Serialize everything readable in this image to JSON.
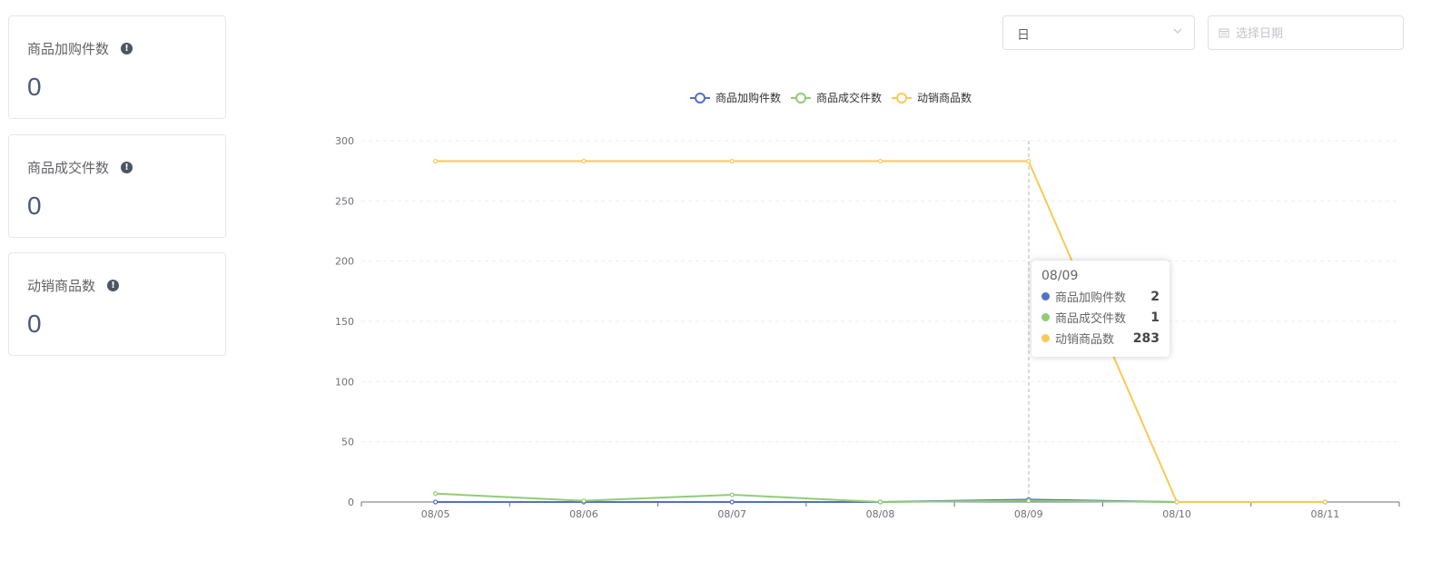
{
  "cards": [
    {
      "title": "商品加购件数",
      "value": "0",
      "info_icon": "!"
    },
    {
      "title": "商品成交件数",
      "value": "0",
      "info_icon": "!"
    },
    {
      "title": "动销商品数",
      "value": "0",
      "info_icon": "!"
    }
  ],
  "controls": {
    "granularity_value": "日",
    "date_placeholder": "选择日期"
  },
  "chart_data": {
    "type": "line",
    "categories": [
      "08/05",
      "08/06",
      "08/07",
      "08/08",
      "08/09",
      "08/10",
      "08/11"
    ],
    "ylim": [
      0,
      300
    ],
    "yticks": [
      0,
      50,
      100,
      150,
      200,
      250,
      300
    ],
    "grid": true,
    "legend_position": "top-center",
    "series": [
      {
        "name": "商品加购件数",
        "color": "#5470c6",
        "values": [
          0,
          0,
          0,
          0,
          2,
          0,
          0
        ]
      },
      {
        "name": "商品成交件数",
        "color": "#91cc75",
        "values": [
          7,
          1,
          6,
          0,
          1,
          0,
          0
        ]
      },
      {
        "name": "动销商品数",
        "color": "#fac858",
        "values": [
          283,
          283,
          283,
          283,
          283,
          0,
          0
        ]
      }
    ]
  },
  "tooltip": {
    "title": "08/09",
    "rows": [
      {
        "name": "商品加购件数",
        "value": "2",
        "color": "#5470c6"
      },
      {
        "name": "商品成交件数",
        "value": "1",
        "color": "#91cc75"
      },
      {
        "name": "动销商品数",
        "value": "283",
        "color": "#fac858"
      }
    ]
  }
}
